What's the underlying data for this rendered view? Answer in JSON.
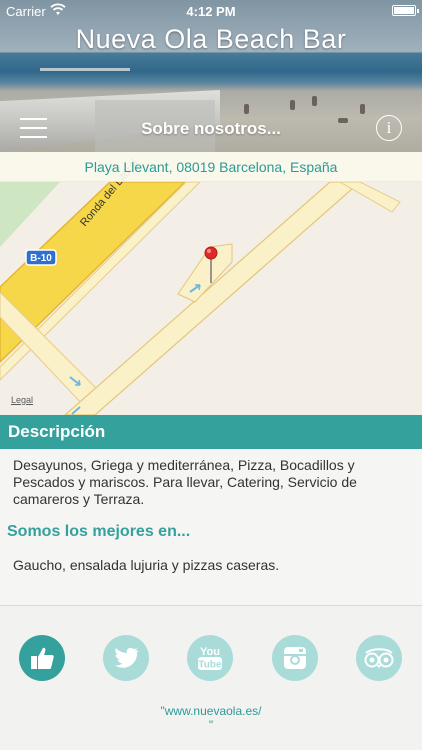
{
  "status_bar": {
    "carrier": "Carrier",
    "time": "4:12 PM"
  },
  "header": {
    "app_title": "Nueva Ola Beach Bar",
    "nav_title": "Sobre nosotros..."
  },
  "map": {
    "address": "Playa Llevant, 08019 Barcelona, España",
    "street_label": "Ronda del Litoral",
    "highway_label": "B-10",
    "legal_label": "Legal"
  },
  "description": {
    "title": "Descripción",
    "text": "Desayunos, Griega y mediterránea, Pizza, Bocadillos y Pescados y mariscos. Para llevar, Catering, Servicio de camareros y Terraza."
  },
  "best_at": {
    "title": "Somos los mejores en...",
    "text": "Gaucho, ensalada lujuria y pizzas caseras."
  },
  "social": [
    {
      "name": "facebook-like",
      "icon": "thumbs-up-icon",
      "active": true
    },
    {
      "name": "twitter",
      "icon": "bird-icon",
      "active": false
    },
    {
      "name": "youtube",
      "icon": "youtube-icon",
      "label": "You Tube",
      "active": false
    },
    {
      "name": "instagram",
      "icon": "camera-icon",
      "active": false
    },
    {
      "name": "tripadvisor",
      "icon": "owl-icon",
      "active": false
    }
  ],
  "website": {
    "line1": "\"www.nuevaola.es/",
    "line2": "\""
  },
  "colors": {
    "accent": "#35a19c",
    "accent_light": "#a9dcd9",
    "link": "#2b9a98",
    "road_yellow": "#f7d74a"
  }
}
